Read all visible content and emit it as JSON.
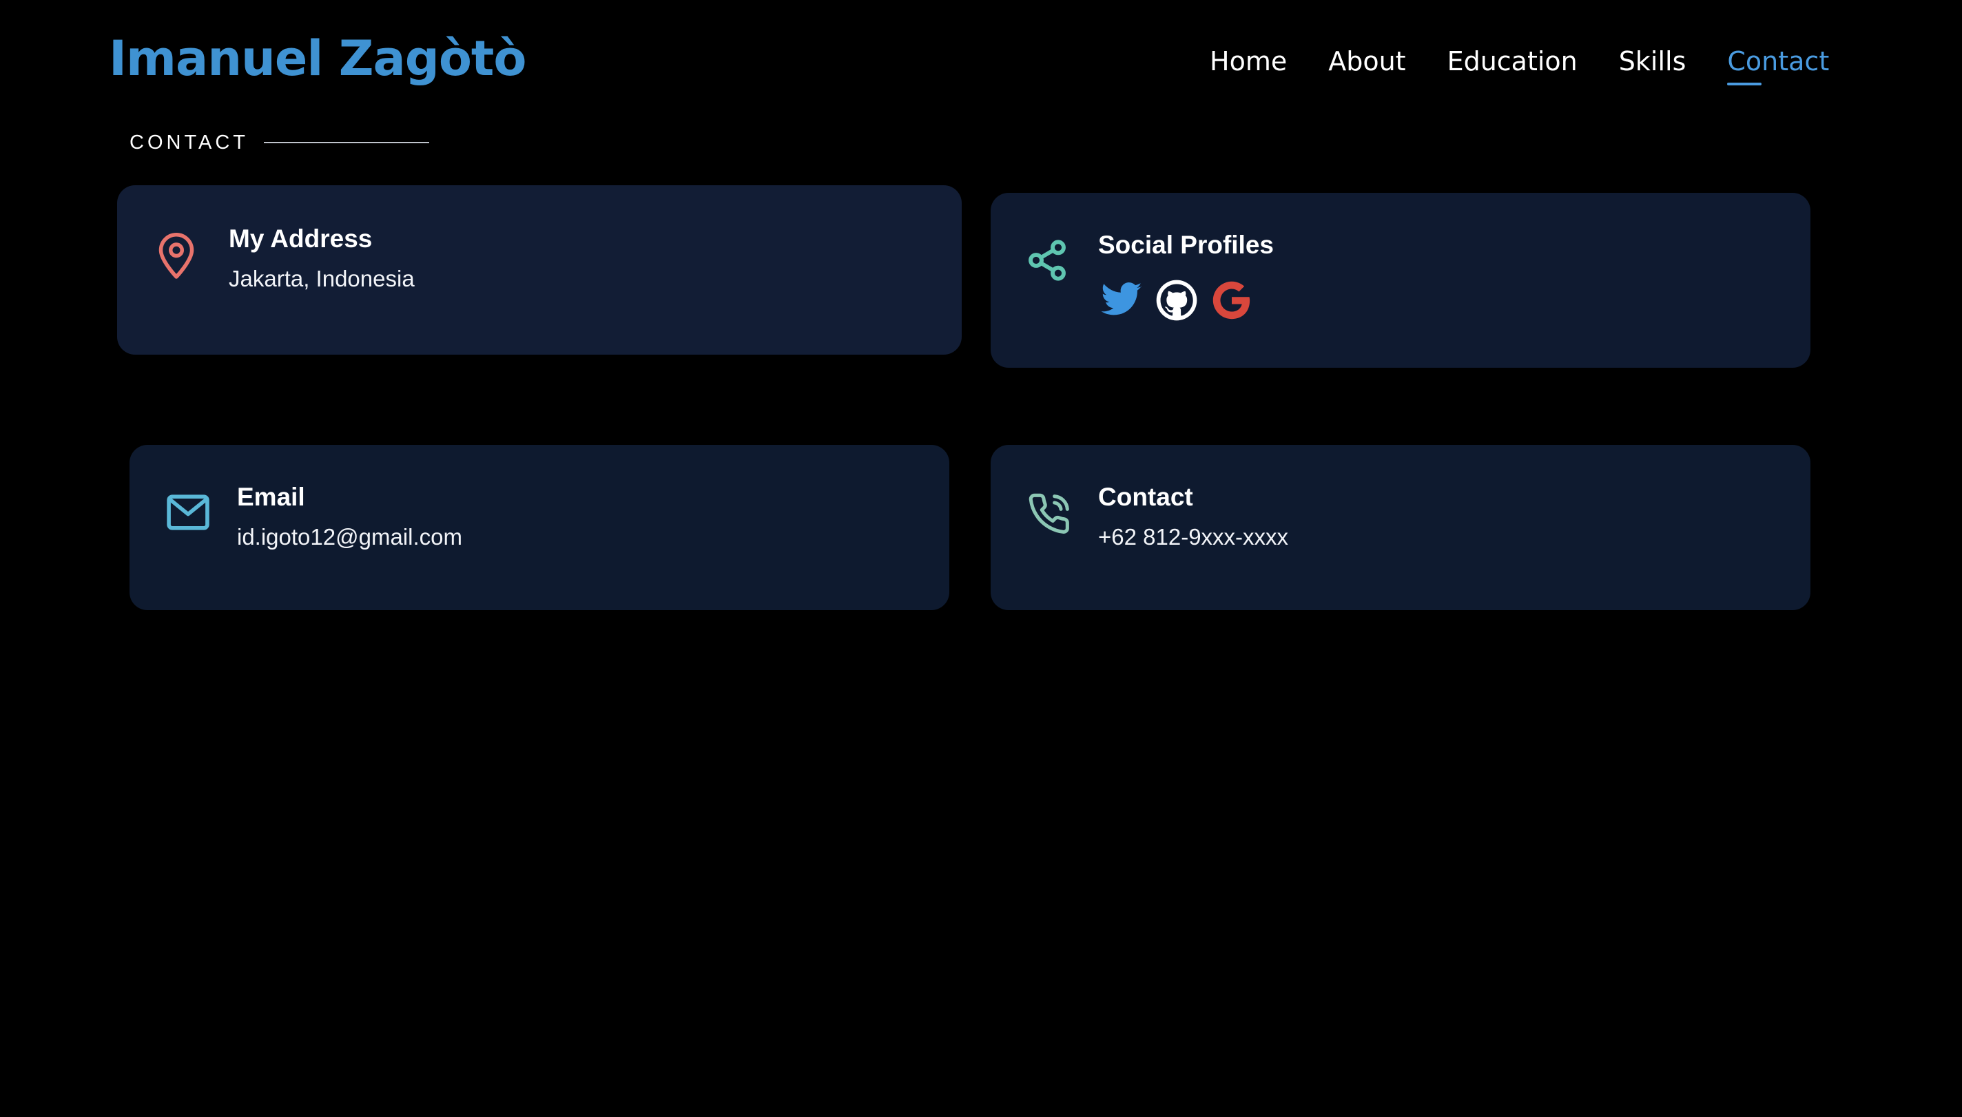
{
  "header": {
    "logo": "Imanuel Zagòtò",
    "nav": [
      {
        "label": "Home"
      },
      {
        "label": "About"
      },
      {
        "label": "Education"
      },
      {
        "label": "Skills"
      },
      {
        "label": "Contact",
        "active": true
      }
    ]
  },
  "section": {
    "label": "CONTACT"
  },
  "cards": {
    "address": {
      "title": "My Address",
      "value": "Jakarta, Indonesia",
      "icon": "map-pin-icon"
    },
    "social": {
      "title": "Social Profiles",
      "icon": "share-icon",
      "links": [
        {
          "icon": "twitter-icon",
          "color": "#3d95e0"
        },
        {
          "icon": "github-icon",
          "color": "#ffffff"
        },
        {
          "icon": "google-icon",
          "color": "#d9473c"
        }
      ]
    },
    "email": {
      "title": "Email",
      "value": "id.igoto12@gmail.com",
      "icon": "mail-icon"
    },
    "contact": {
      "title": "Contact",
      "value": "+62 812-9xxx-xxxx",
      "icon": "phone-call-icon"
    }
  },
  "colors": {
    "accent": "#3f92d2",
    "background": "#000000",
    "card": "#101c33",
    "pin": "#e8736c",
    "share": "#5fc5b0",
    "mail": "#5ab8d8",
    "phone": "#8cc7b4"
  }
}
